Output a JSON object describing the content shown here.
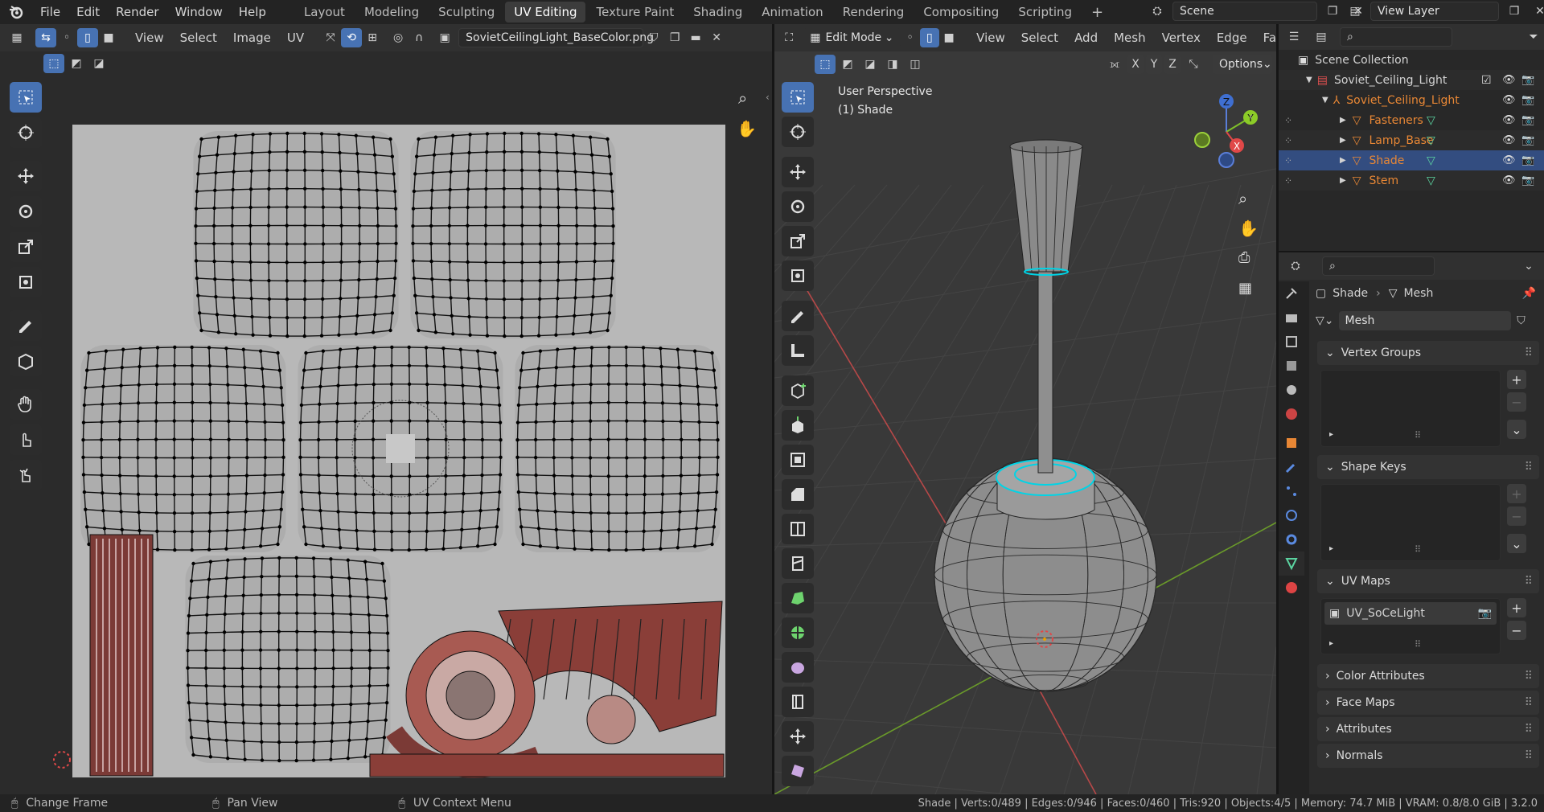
{
  "topbar": {
    "menus": [
      "File",
      "Edit",
      "Render",
      "Window",
      "Help"
    ],
    "workspaces": [
      "Layout",
      "Modeling",
      "Sculpting",
      "UV Editing",
      "Texture Paint",
      "Shading",
      "Animation",
      "Rendering",
      "Compositing",
      "Scripting"
    ],
    "active_workspace": "UV Editing",
    "scene": "Scene",
    "view_layer": "View Layer"
  },
  "uv_editor": {
    "menus": [
      "View",
      "Select",
      "Image",
      "UV"
    ],
    "image_name": "SovietCeilingLight_BaseColor.png"
  },
  "viewport": {
    "mode": "Edit Mode",
    "menus": [
      "View",
      "Select",
      "Add",
      "Mesh",
      "Vertex",
      "Edge",
      "Fa"
    ],
    "axes": [
      "X",
      "Y",
      "Z"
    ],
    "options_label": "Options",
    "overlay_title": "User Perspective",
    "overlay_subtitle": "(1) Shade"
  },
  "outliner": {
    "root": "Scene Collection",
    "collection": "Soviet_Ceiling_Light",
    "armature": "Soviet_Ceiling_Light",
    "objects": [
      {
        "name": "Fasteners",
        "selected": false
      },
      {
        "name": "Lamp_Base",
        "selected": false
      },
      {
        "name": "Shade",
        "selected": true
      },
      {
        "name": "Stem",
        "selected": false
      }
    ]
  },
  "properties": {
    "breadcrumb_object": "Shade",
    "breadcrumb_data": "Mesh",
    "mesh_name": "Mesh",
    "panels": {
      "vertex_groups": "Vertex Groups",
      "shape_keys": "Shape Keys",
      "uv_maps": "UV Maps",
      "color_attributes": "Color Attributes",
      "face_maps": "Face Maps",
      "attributes": "Attributes",
      "normals": "Normals"
    },
    "uv_map_name": "UV_SoCeLight"
  },
  "statusbar": {
    "left1": "Change Frame",
    "left2": "Pan View",
    "left3": "UV Context Menu",
    "stats": "Shade | Verts:0/489 | Edges:0/946 | Faces:0/460 | Tris:920 | Objects:4/5 | Memory: 74.7 MiB | VRAM: 0.8/8.0 GiB | 3.2.0"
  },
  "colors": {
    "accent": "#4772b3",
    "selection_edge": "#00d4e6",
    "mesh_icon": "#e88735",
    "outliner_selected": "#334d80"
  }
}
